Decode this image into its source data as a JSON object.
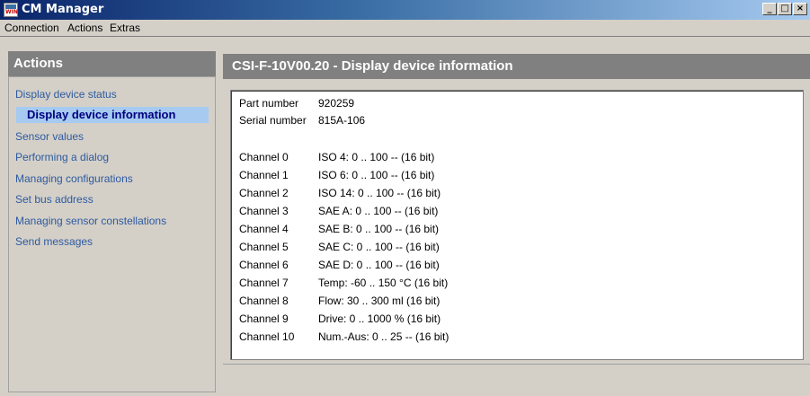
{
  "window": {
    "title": "CM Manager",
    "icon_label": "WIN",
    "controls": {
      "minimize": "_",
      "maximize": "□",
      "close": "×"
    }
  },
  "menubar": {
    "items": [
      {
        "label": "Connection"
      },
      {
        "label": "Actions"
      },
      {
        "label": "Extras"
      }
    ]
  },
  "sidebar": {
    "header": "Actions",
    "items": [
      {
        "label": "Display device status",
        "active": false
      },
      {
        "label": "Display device information",
        "active": true
      },
      {
        "label": "Sensor values",
        "active": false
      },
      {
        "label": "Performing a dialog",
        "active": false
      },
      {
        "label": "Managing configurations",
        "active": false
      },
      {
        "label": "Set bus address",
        "active": false
      },
      {
        "label": "Managing sensor constellations",
        "active": false
      },
      {
        "label": "Send messages",
        "active": false
      }
    ]
  },
  "main": {
    "header": "CSI-F-10V00.20 - Display device information",
    "device": {
      "part_number_label": "Part number",
      "part_number": "920259",
      "serial_number_label": "Serial number",
      "serial_number": "815A-106"
    },
    "channels": [
      {
        "label": "Channel 0",
        "value": "ISO 4: 0 .. 100 -- (16 bit)"
      },
      {
        "label": "Channel 1",
        "value": "ISO 6: 0 .. 100 -- (16 bit)"
      },
      {
        "label": "Channel 2",
        "value": "ISO 14: 0 .. 100 -- (16 bit)"
      },
      {
        "label": "Channel 3",
        "value": "SAE A: 0 .. 100 -- (16 bit)"
      },
      {
        "label": "Channel 4",
        "value": "SAE B: 0 .. 100 -- (16 bit)"
      },
      {
        "label": "Channel 5",
        "value": "SAE C: 0 .. 100 -- (16 bit)"
      },
      {
        "label": "Channel 6",
        "value": "SAE D: 0 .. 100 -- (16 bit)"
      },
      {
        "label": "Channel 7",
        "value": "Temp: -60 .. 150 °C (16 bit)"
      },
      {
        "label": "Channel 8",
        "value": "Flow: 30 .. 300 ml (16 bit)"
      },
      {
        "label": "Channel 9",
        "value": "Drive: 0 .. 1000 % (16 bit)"
      },
      {
        "label": "Channel 10",
        "value": "Num.-Aus: 0 .. 25 -- (16 bit)"
      }
    ]
  },
  "colors": {
    "titlebar_start": "#0a246a",
    "panel_header": "#808080",
    "nav_link": "#2d5aa0",
    "nav_active_bg": "#a6caf0"
  }
}
